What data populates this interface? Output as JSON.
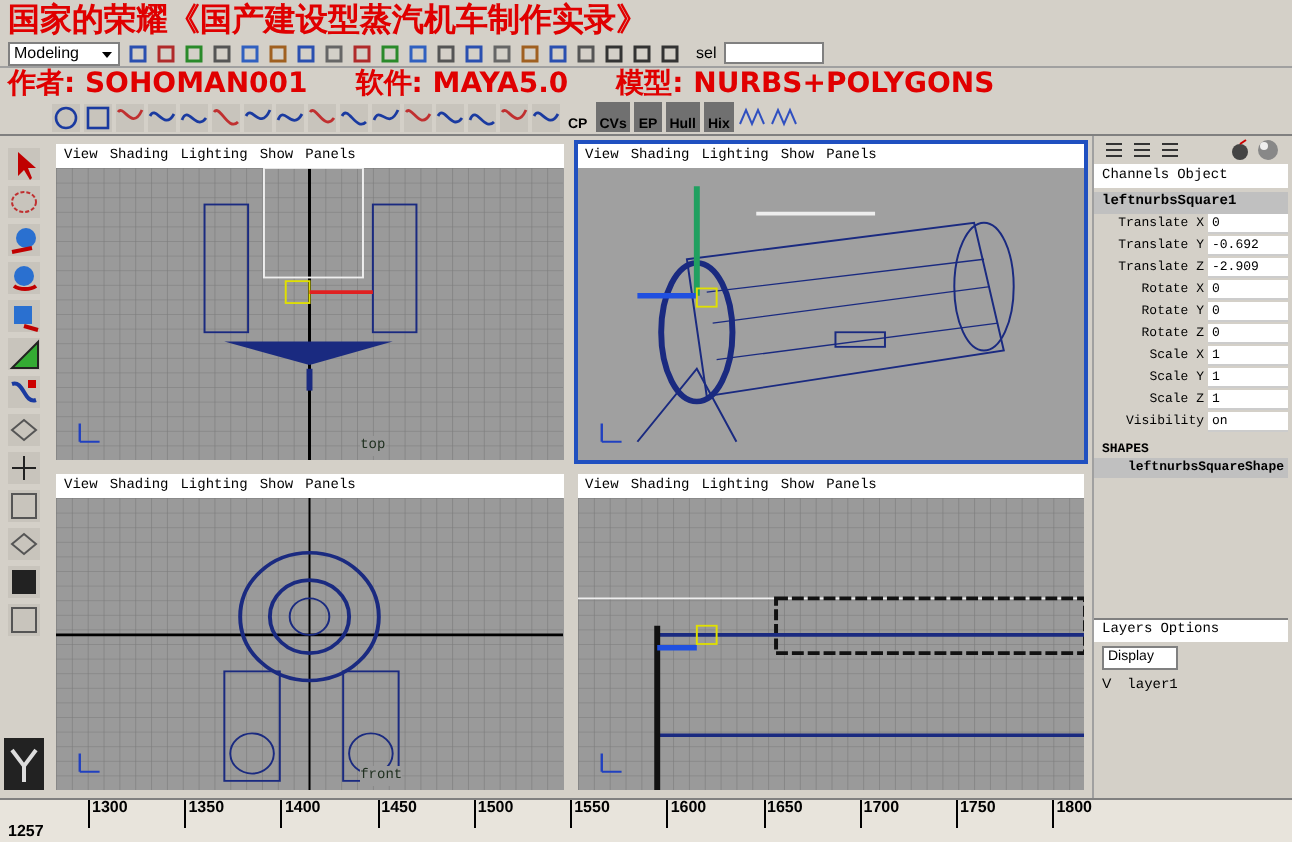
{
  "overlay_title": {
    "line_1": "国家的荣耀《国产建设型蒸汽机车制作实录》",
    "line_2": [
      "作者: SOHOMAN001",
      "软件: MAYA5.0",
      "模型: NURBS+POLYGONS"
    ]
  },
  "status_line": {
    "mode": "Modeling",
    "field": "sel"
  },
  "shelf": {
    "labels": [
      "CP",
      "CVs",
      "EP",
      "Hull",
      "Hix"
    ]
  },
  "viewports": [
    {
      "kind": "top",
      "menus": [
        "View",
        "Shading",
        "Lighting",
        "Show",
        "Panels"
      ],
      "label": "top",
      "selected": false
    },
    {
      "kind": "perspective",
      "menus": [
        "View",
        "Shading",
        "Lighting",
        "Show",
        "Panels"
      ],
      "selected": true
    },
    {
      "kind": "front",
      "menus": [
        "View",
        "Shading",
        "Lighting",
        "Show",
        "Panels"
      ],
      "label": "front",
      "selected": false
    },
    {
      "kind": "side",
      "menus": [
        "View",
        "Shading",
        "Lighting",
        "Show",
        "Panels"
      ],
      "selected": false
    }
  ],
  "channel_box": {
    "menus": [
      "Channels",
      "Object"
    ],
    "object": "leftnurbsSquare1",
    "attributes": [
      {
        "name": "Translate X",
        "value": "0"
      },
      {
        "name": "Translate Y",
        "value": "-0.692"
      },
      {
        "name": "Translate Z",
        "value": "-2.909"
      },
      {
        "name": "Rotate X",
        "value": "0"
      },
      {
        "name": "Rotate Y",
        "value": "0"
      },
      {
        "name": "Rotate Z",
        "value": "0"
      },
      {
        "name": "Scale X",
        "value": "1"
      },
      {
        "name": "Scale Y",
        "value": "1"
      },
      {
        "name": "Scale Z",
        "value": "1"
      },
      {
        "name": "Visibility",
        "value": "on"
      }
    ],
    "shapes_heading": "SHAPES",
    "shape": "leftnurbsSquareShape"
  },
  "layers": {
    "menus": [
      "Layers",
      "Options"
    ],
    "display": "Display",
    "layer": {
      "visible_mark": "V",
      "name": "layer1"
    }
  },
  "timeline": {
    "ticks": [
      "1300",
      "1350",
      "1400",
      "1450",
      "1500",
      "1550",
      "1600",
      "1650",
      "1700",
      "1750",
      "1800"
    ],
    "current": "1257"
  }
}
